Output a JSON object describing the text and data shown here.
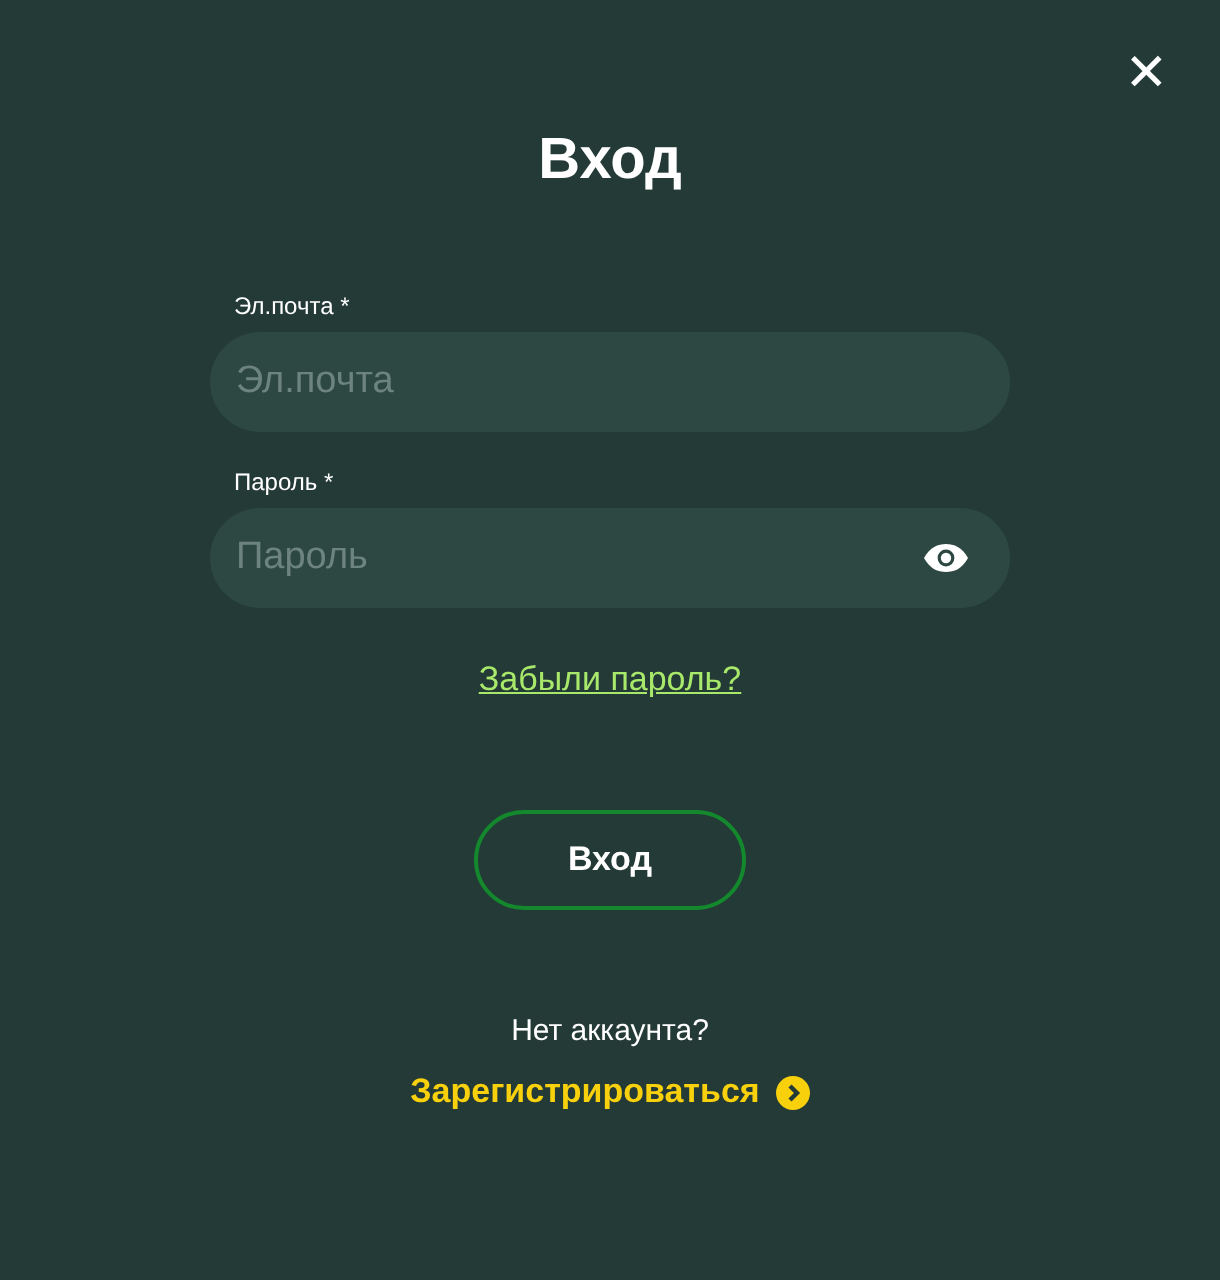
{
  "close_button": {
    "label": "✕"
  },
  "title": "Вход",
  "fields": [
    {
      "label": "Эл.почта *",
      "placeholder": "Эл.почта",
      "kind": "text"
    },
    {
      "label": "Пароль *",
      "placeholder": "Пароль",
      "kind": "password"
    }
  ],
  "forgot_link": "Забыли пароль?",
  "submit_button": "Вход",
  "signup_prompt": "Нет аккаунта?",
  "signup_link": "Зарегистрироваться"
}
